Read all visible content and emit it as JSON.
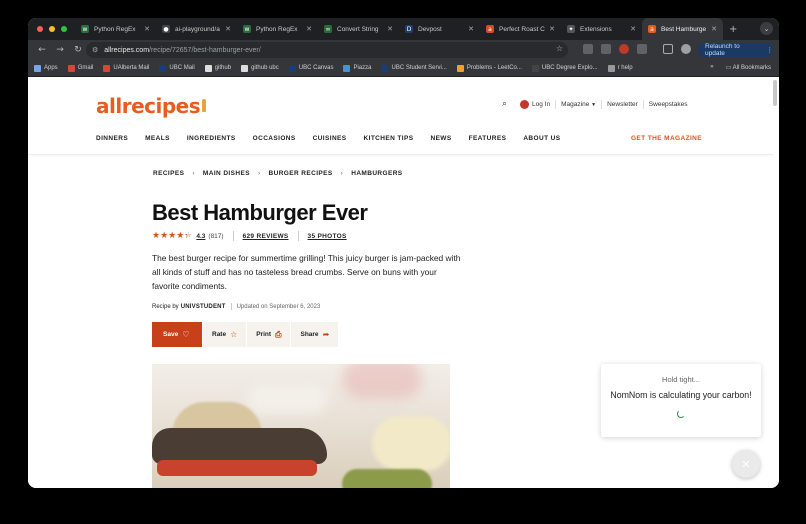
{
  "browser": {
    "tabs": [
      {
        "label": "Python RegEx",
        "favicon": "w",
        "favcolor": "#2a6e3f",
        "active": false
      },
      {
        "label": "ai-playground/a",
        "favicon": "●",
        "favcolor": "#444",
        "active": false
      },
      {
        "label": "Python RegEx",
        "favicon": "w",
        "favcolor": "#2a6e3f",
        "active": false
      },
      {
        "label": "Convert String",
        "favicon": "∞",
        "favcolor": "#2b6b3a",
        "active": false
      },
      {
        "label": "Devpost",
        "favicon": "D",
        "favcolor": "#1f3c6e",
        "active": false
      },
      {
        "label": "Perfect Roast C",
        "favicon": "a",
        "favcolor": "#d64a2a",
        "active": false
      },
      {
        "label": "Extensions",
        "favicon": "✦",
        "favcolor": "#555",
        "active": false
      },
      {
        "label": "Best Hamburge",
        "favicon": "a",
        "favcolor": "#e85c1d",
        "active": true
      }
    ],
    "url_host": "allrecipes.com",
    "url_path": "/recipe/72657/best-hamburger-ever/",
    "relaunch_label": "Relaunch to update",
    "bookmarks": [
      {
        "label": "Apps",
        "color": "#7aa4e8"
      },
      {
        "label": "Gmail",
        "color": "#d44638"
      },
      {
        "label": "UAlberta Mail",
        "color": "#d44638"
      },
      {
        "label": "UBC Mail",
        "color": "#1c3b7a"
      },
      {
        "label": "github",
        "color": "#ddd"
      },
      {
        "label": "github ubc",
        "color": "#ddd"
      },
      {
        "label": "UBC Canvas",
        "color": "#1c3b7a"
      },
      {
        "label": "Piazza",
        "color": "#4a90d9"
      },
      {
        "label": "UBC Student Servi...",
        "color": "#1c3b7a"
      },
      {
        "label": "Problems - LeetCo...",
        "color": "#f0a030"
      },
      {
        "label": "UBC Degree Explo...",
        "color": "#444"
      },
      {
        "label": "r help",
        "color": "#999"
      }
    ],
    "all_bookmarks_label": "All Bookmarks",
    "more_label": "»"
  },
  "site": {
    "logo": "allrecipes",
    "login": "Log In",
    "magazine": "Magazine",
    "newsletter": "Newsletter",
    "sweepstakes": "Sweepstakes",
    "nav": [
      "DINNERS",
      "MEALS",
      "INGREDIENTS",
      "OCCASIONS",
      "CUISINES",
      "KITCHEN TIPS",
      "NEWS",
      "FEATURES",
      "ABOUT US"
    ],
    "get_magazine": "GET THE MAGAZINE",
    "accent": "#d4561b"
  },
  "recipe": {
    "breadcrumbs": [
      "RECIPES",
      "MAIN DISHES",
      "BURGER RECIPES",
      "HAMBURGERS"
    ],
    "title": "Best Hamburger Ever",
    "rating_value": "4.3",
    "rating_stars": 4.3,
    "rating_count": "(817)",
    "reviews": "629 REVIEWS",
    "photos": "35 PHOTOS",
    "description": "The best burger recipe for summertime grilling! This juicy burger is jam-packed with all kinds of stuff and has no tasteless bread crumbs. Serve on buns with your favorite condiments.",
    "recipe_by_label": "Recipe by",
    "author": "UNIVSTUDENT",
    "updated": "Updated on September 6, 2023",
    "actions": {
      "save": "Save",
      "rate": "Rate",
      "print": "Print",
      "share": "Share"
    }
  },
  "widget": {
    "hold": "Hold tight...",
    "message": "NomNom is calculating your carbon!"
  }
}
